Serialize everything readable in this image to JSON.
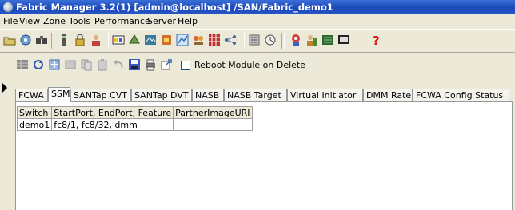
{
  "window": {
    "title": "Fabric Manager 3.2(1) [admin@localhost] /SAN/Fabric_demo1"
  },
  "menu": [
    "File",
    "View",
    "Zone",
    "Tools",
    "Performance",
    "Server",
    "Help"
  ],
  "toolbar": {
    "icons": [
      "open-icon",
      "discover-icon",
      "find-icon",
      "switch-icon",
      "lock-icon",
      "users-icon",
      "zone-icon",
      "fabric-icon",
      "device-manager-icon",
      "flow-icon",
      "chart-icon",
      "vsan-icon",
      "layout-icon",
      "topology-icon",
      "log-icon",
      "alarm-icon",
      "security-icon",
      "report-icon",
      "monitor-icon",
      "help-icon"
    ]
  },
  "module_toolbar": {
    "reboot_label": "Reboot Module on Delete",
    "reboot_checked": false
  },
  "tabs": [
    "FCWA",
    "SSM",
    "SANTap CVT",
    "SANTap DVT",
    "NASB",
    "NASB Target",
    "Virtual Initiator",
    "DMM Rate",
    "FCWA Config Status"
  ],
  "selected_tab": "SSM",
  "table": {
    "headers": [
      "Switch",
      "StartPort, EndPort, Feature",
      "PartnerImageURI"
    ],
    "rows": [
      [
        "demo1",
        "fc8/1, fc8/32, dmm",
        ""
      ]
    ]
  }
}
